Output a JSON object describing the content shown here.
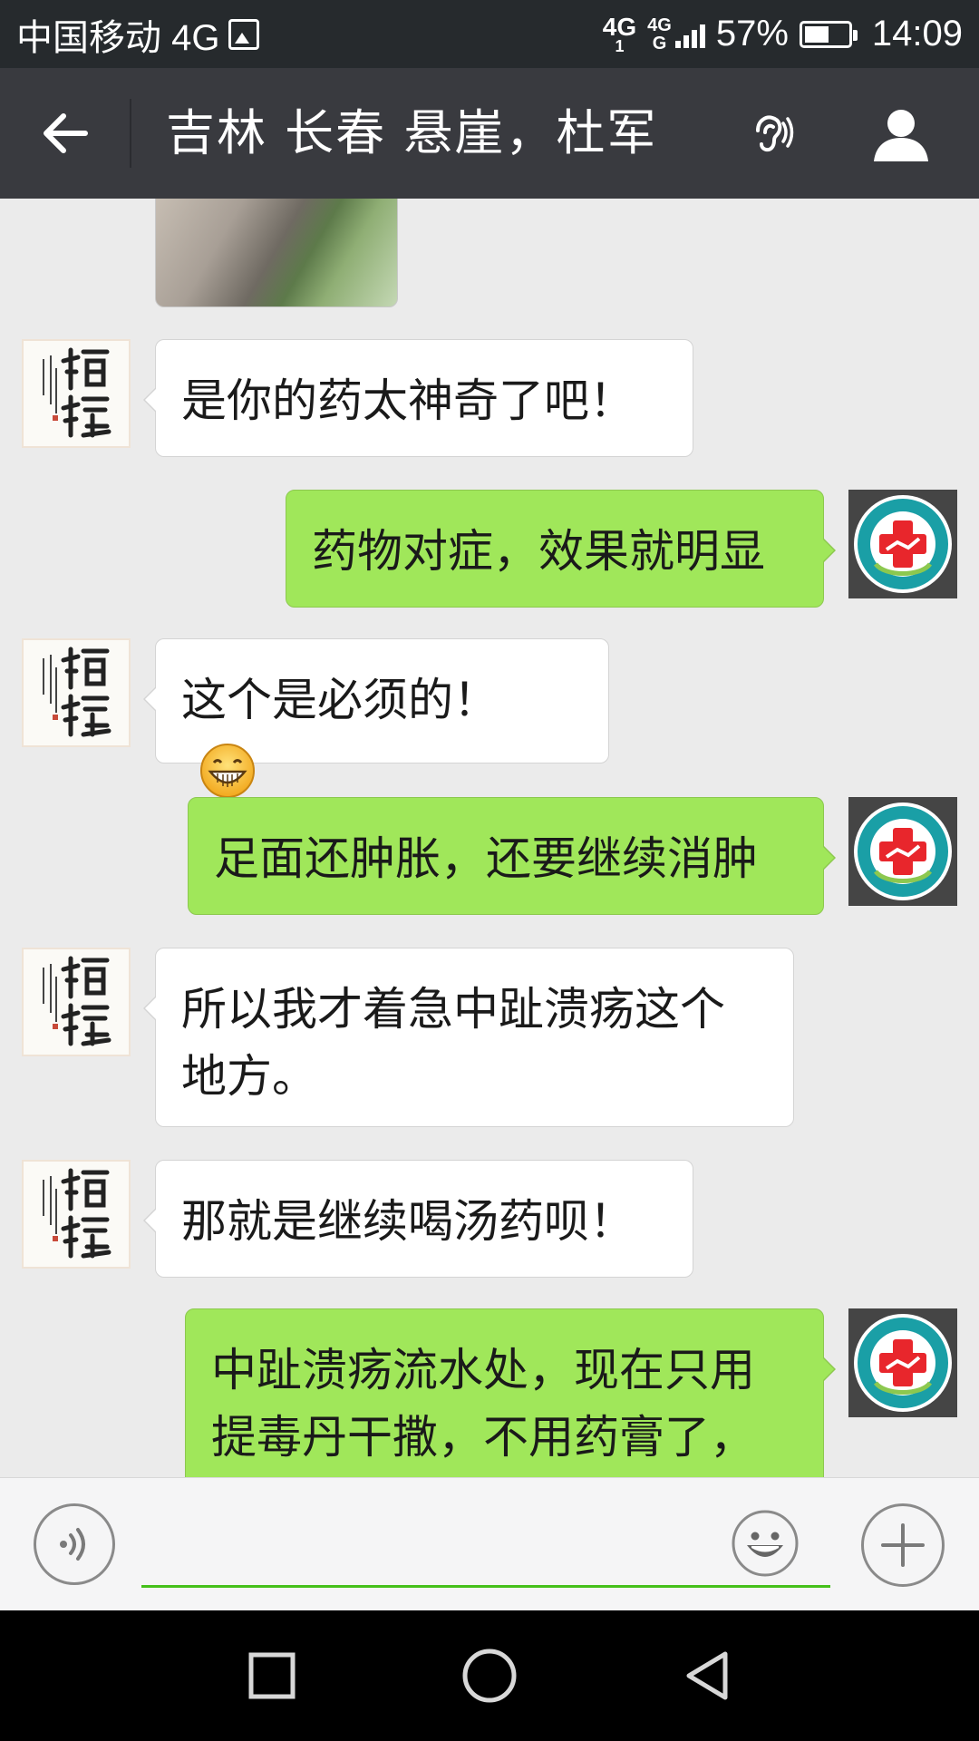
{
  "status_bar": {
    "carrier": "中国移动 4G",
    "net_primary_top": "4G",
    "net_primary_bottom": "1",
    "net_secondary_top": "4G",
    "net_secondary_bottom": "G",
    "battery_percent": "57%",
    "battery_level": 0.57,
    "time": "14:09"
  },
  "header": {
    "title": "吉林  长春  悬崖，杜军"
  },
  "messages": [
    {
      "side": "in",
      "text": "是你的药太神奇了吧！"
    },
    {
      "side": "out",
      "text": "药物对症，效果就明显"
    },
    {
      "side": "in",
      "text": "这个是必须的！"
    },
    {
      "side": "out",
      "text": "足面还肿胀，还要继续消肿"
    },
    {
      "side": "in",
      "text": "所以我才着急中趾溃疡这个地方。"
    },
    {
      "side": "in",
      "text": "那就是继续喝汤药呗！"
    },
    {
      "side": "out",
      "text": "中趾溃疡流水处，现在只用提毒丹干撒，不用药膏了，"
    }
  ],
  "input": {
    "value": "",
    "placeholder": ""
  },
  "colors": {
    "header_bg": "#393a3f",
    "status_bg": "#262a2d",
    "chat_bg": "#ebebeb",
    "outgoing_bubble": "#a0e75a",
    "incoming_bubble": "#ffffff",
    "input_underline": "#45c01a",
    "clinic_red": "#e8262c",
    "clinic_teal": "#1a9fa6"
  },
  "icons": {
    "back": "arrow-left-icon",
    "ear": "ear-icon",
    "profile": "person-icon",
    "voice": "voice-icon",
    "emoji": "smiley-icon",
    "plus": "plus-icon",
    "nav_recent": "square-icon",
    "nav_home": "circle-icon",
    "nav_back": "triangle-back-icon"
  }
}
